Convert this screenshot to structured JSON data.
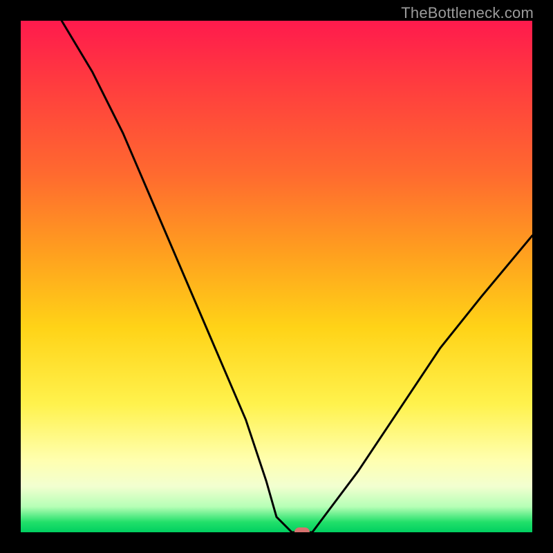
{
  "watermark": {
    "text": "TheBottleneck.com"
  },
  "chart_data": {
    "type": "line",
    "title": "",
    "xlabel": "",
    "ylabel": "",
    "xlim": [
      0,
      100
    ],
    "ylim": [
      0,
      100
    ],
    "grid": false,
    "legend": null,
    "background_gradient_stops": [
      {
        "pct": 0,
        "color": "#ff1a4d"
      },
      {
        "pct": 12,
        "color": "#ff3b3f"
      },
      {
        "pct": 30,
        "color": "#ff6a2f"
      },
      {
        "pct": 45,
        "color": "#ff9e1f"
      },
      {
        "pct": 60,
        "color": "#ffd317"
      },
      {
        "pct": 75,
        "color": "#fff24d"
      },
      {
        "pct": 86,
        "color": "#ffffb0"
      },
      {
        "pct": 91,
        "color": "#f2ffd0"
      },
      {
        "pct": 95,
        "color": "#b6ffb6"
      },
      {
        "pct": 98,
        "color": "#22e06a"
      },
      {
        "pct": 100,
        "color": "#00cf60"
      }
    ],
    "series": [
      {
        "name": "bottleneck-curve",
        "color": "#000000",
        "stroke_width": 3,
        "x": [
          8,
          14,
          20,
          26,
          32,
          38,
          44,
          48,
          50,
          53,
          55,
          57,
          60,
          66,
          74,
          82,
          90,
          100
        ],
        "y": [
          100,
          90,
          78,
          64,
          50,
          36,
          22,
          10,
          3,
          0,
          0,
          0,
          4,
          12,
          24,
          36,
          46,
          58
        ]
      }
    ],
    "marker": {
      "name": "valley-marker",
      "x": 55,
      "y": 0,
      "color": "#d6716e",
      "shape": "rounded-pill"
    }
  }
}
